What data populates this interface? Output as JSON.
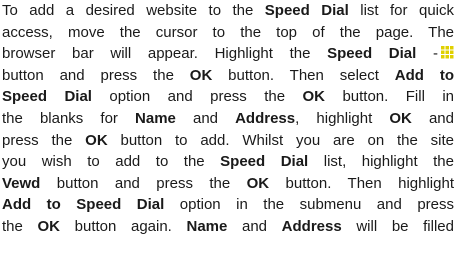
{
  "paragraph": {
    "lines": [
      [
        {
          "t": "To add a desired website to the ",
          "b": false
        },
        {
          "t": "Speed Dial",
          "b": true
        },
        {
          "t": " list for quick",
          "b": false
        }
      ],
      [
        {
          "t": "access, move the cursor to the top of the page. The",
          "b": false
        }
      ],
      [
        {
          "t": "browser bar will appear. Highlight the ",
          "b": false
        },
        {
          "t": "Speed Dial",
          "b": true
        },
        {
          "t": " -",
          "b": false
        },
        {
          "icon": "speed-dial-grid-icon"
        }
      ],
      [
        {
          "t": "button and press the ",
          "b": false
        },
        {
          "t": "OK",
          "b": true
        },
        {
          "t": " button. Then select ",
          "b": false
        },
        {
          "t": "Add to",
          "b": true
        }
      ],
      [
        {
          "t": "Speed Dial",
          "b": true
        },
        {
          "t": " option and press the ",
          "b": false
        },
        {
          "t": "OK",
          "b": true
        },
        {
          "t": " button. Fill in",
          "b": false
        }
      ],
      [
        {
          "t": "the blanks for ",
          "b": false
        },
        {
          "t": "Name",
          "b": true
        },
        {
          "t": " and ",
          "b": false
        },
        {
          "t": "Address",
          "b": true
        },
        {
          "t": ", highlight ",
          "b": false
        },
        {
          "t": "OK",
          "b": true
        },
        {
          "t": " and",
          "b": false
        }
      ],
      [
        {
          "t": "press the ",
          "b": false
        },
        {
          "t": "OK",
          "b": true
        },
        {
          "t": " button to add. Whilst you are on the site",
          "b": false
        }
      ],
      [
        {
          "t": "you wish to add to the ",
          "b": false
        },
        {
          "t": "Speed Dial",
          "b": true
        },
        {
          "t": " list, highlight the",
          "b": false
        }
      ],
      [
        {
          "t": "Vewd",
          "b": true
        },
        {
          "t": " button and press the ",
          "b": false
        },
        {
          "t": "OK",
          "b": true
        },
        {
          "t": " button. Then highlight",
          "b": false
        }
      ],
      [
        {
          "t": "Add to Speed Dial",
          "b": true
        },
        {
          "t": " option in the submenu and press",
          "b": false
        }
      ],
      [
        {
          "t": "the ",
          "b": false
        },
        {
          "t": "OK",
          "b": true
        },
        {
          "t": " button again. ",
          "b": false
        },
        {
          "t": "Name",
          "b": true
        },
        {
          "t": " and ",
          "b": false
        },
        {
          "t": "Address",
          "b": true
        },
        {
          "t": " will be filled",
          "b": false
        }
      ]
    ]
  },
  "icon_color": "#e0d000"
}
